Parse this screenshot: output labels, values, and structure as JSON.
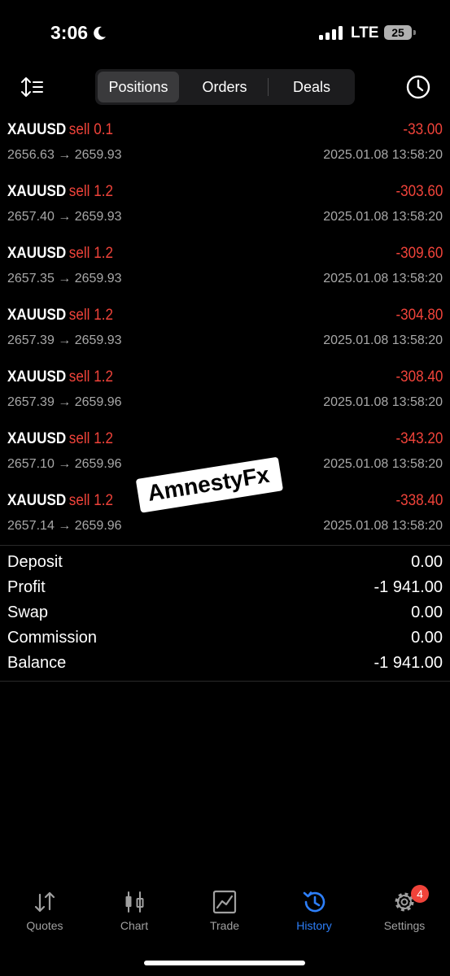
{
  "status_bar": {
    "time": "3:06",
    "network": "LTE",
    "battery": "25"
  },
  "header": {
    "tabs": [
      "Positions",
      "Orders",
      "Deals"
    ],
    "active_tab": "Positions"
  },
  "positions": [
    {
      "symbol": "XAUUSD",
      "side": "sell 0.1",
      "profit": "-33.00",
      "prices": "2656.63 → 2659.93",
      "time": "2025.01.08 13:58:20"
    },
    {
      "symbol": "XAUUSD",
      "side": "sell 1.2",
      "profit": "-303.60",
      "prices": "2657.40 → 2659.93",
      "time": "2025.01.08 13:58:20"
    },
    {
      "symbol": "XAUUSD",
      "side": "sell 1.2",
      "profit": "-309.60",
      "prices": "2657.35 → 2659.93",
      "time": "2025.01.08 13:58:20"
    },
    {
      "symbol": "XAUUSD",
      "side": "sell 1.2",
      "profit": "-304.80",
      "prices": "2657.39 → 2659.93",
      "time": "2025.01.08 13:58:20"
    },
    {
      "symbol": "XAUUSD",
      "side": "sell 1.2",
      "profit": "-308.40",
      "prices": "2657.39 → 2659.96",
      "time": "2025.01.08 13:58:20"
    },
    {
      "symbol": "XAUUSD",
      "side": "sell 1.2",
      "profit": "-343.20",
      "prices": "2657.10 → 2659.96",
      "time": "2025.01.08 13:58:20"
    },
    {
      "symbol": "XAUUSD",
      "side": "sell 1.2",
      "profit": "-338.40",
      "prices": "2657.14 → 2659.96",
      "time": "2025.01.08 13:58:20"
    }
  ],
  "watermark": "AmnestyFx",
  "summary": [
    {
      "label": "Deposit",
      "value": "0.00"
    },
    {
      "label": "Profit",
      "value": "-1 941.00"
    },
    {
      "label": "Swap",
      "value": "0.00"
    },
    {
      "label": "Commission",
      "value": "0.00"
    },
    {
      "label": "Balance",
      "value": "-1 941.00"
    }
  ],
  "tabbar": {
    "items": [
      {
        "label": "Quotes",
        "icon": "quotes-icon"
      },
      {
        "label": "Chart",
        "icon": "chart-icon"
      },
      {
        "label": "Trade",
        "icon": "trade-icon"
      },
      {
        "label": "History",
        "icon": "history-icon"
      },
      {
        "label": "Settings",
        "icon": "settings-icon"
      }
    ],
    "active": "History",
    "settings_badge": "4"
  },
  "colors": {
    "loss": "#f0433a",
    "accent": "#2d7ff9",
    "muted": "#a8a8a8",
    "background": "#000000"
  }
}
